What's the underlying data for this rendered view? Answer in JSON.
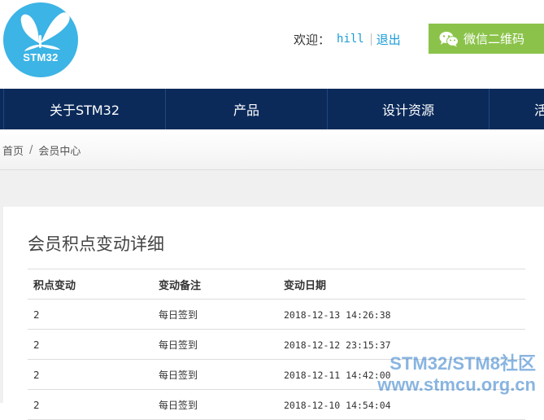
{
  "header": {
    "logo_text": "STM32",
    "welcome": "欢迎：",
    "username": "hill",
    "logout": "退出",
    "wechat_button": "微信二维码"
  },
  "nav": {
    "items": [
      "关于STM32",
      "产品",
      "设计资源",
      "活"
    ]
  },
  "breadcrumb": [
    "首页",
    "会员中心"
  ],
  "breadcrumb_separator": "/",
  "panel": {
    "title": "会员积点变动详细",
    "columns": [
      "积点变动",
      "变动备注",
      "变动日期"
    ],
    "rows": [
      {
        "points": "2",
        "note": "每日签到",
        "date": "2018-12-13 14:26:38"
      },
      {
        "points": "2",
        "note": "每日签到",
        "date": "2018-12-12 23:15:37"
      },
      {
        "points": "2",
        "note": "每日签到",
        "date": "2018-12-11 14:42:00"
      },
      {
        "points": "2",
        "note": "每日签到",
        "date": "2018-12-10 14:54:04"
      }
    ]
  },
  "watermark": {
    "line1": "STM32/STM8社区",
    "line2": "www.stmcu.org.cn"
  },
  "colors": {
    "nav_bg": "#0b2a5a",
    "wechat_green": "#8bc34a",
    "logo_blue": "#3cb4e5",
    "link_blue": "#1a9bd7"
  }
}
